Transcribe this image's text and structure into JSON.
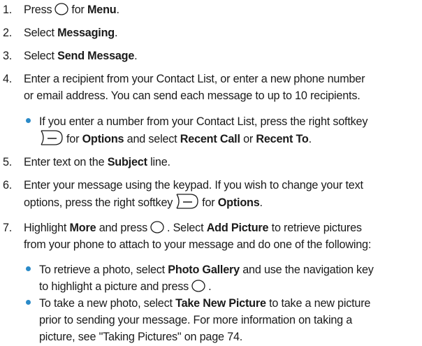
{
  "steps": {
    "s1": {
      "num": "1.",
      "a": "Press",
      "b": "for",
      "c": "Menu",
      "d": "."
    },
    "s2": {
      "num": "2.",
      "a": "Select",
      "b": "Messaging",
      "c": "."
    },
    "s3": {
      "num": "3.",
      "a": "Select",
      "b": "Send Message",
      "c": "."
    },
    "s4": {
      "num": "4.",
      "line1": "Enter a recipient from your Contact List, or enter a new phone number",
      "line2": "or email address. You can send each message to up to 10 recipients.",
      "bullet": {
        "line1": "If you enter a number from your Contact List, press the right softkey",
        "a": "for",
        "b": "Options",
        "c": "and select",
        "d": "Recent Call",
        "e": "or",
        "f": "Recent To",
        "g": "."
      }
    },
    "s5": {
      "num": "5.",
      "a": "Enter text on the",
      "b": "Subject",
      "c": "line."
    },
    "s6": {
      "num": "6.",
      "line1": "Enter your message using the keypad. If you wish to change your text",
      "a": "options, press the right softkey",
      "b": "for",
      "c": "Options",
      "d": "."
    },
    "s7": {
      "num": "7.",
      "a": "Highlight",
      "b": "More",
      "c": "and press",
      "d": ". Select",
      "e": "Add Picture",
      "f": "to retrieve pictures",
      "line2": "from your phone to attach to your message and do one of the following:",
      "bullet1": {
        "a": "To retrieve a photo, select",
        "b": "Photo Gallery",
        "c": "and use the navigation key",
        "d": "to highlight a picture and press",
        "e": "."
      },
      "bullet2": {
        "a": "To take a new photo, select",
        "b": "Take New Picture",
        "c": "to take a new picture",
        "line2": "prior to sending your message. For more information on taking a",
        "line3": "picture, see \"Taking Pictures\" on page 74."
      }
    }
  },
  "icons": {
    "ok_key": "ok-key-circle-icon",
    "softkey": "right-softkey-icon",
    "bullet_color": "#2a8ac8"
  }
}
